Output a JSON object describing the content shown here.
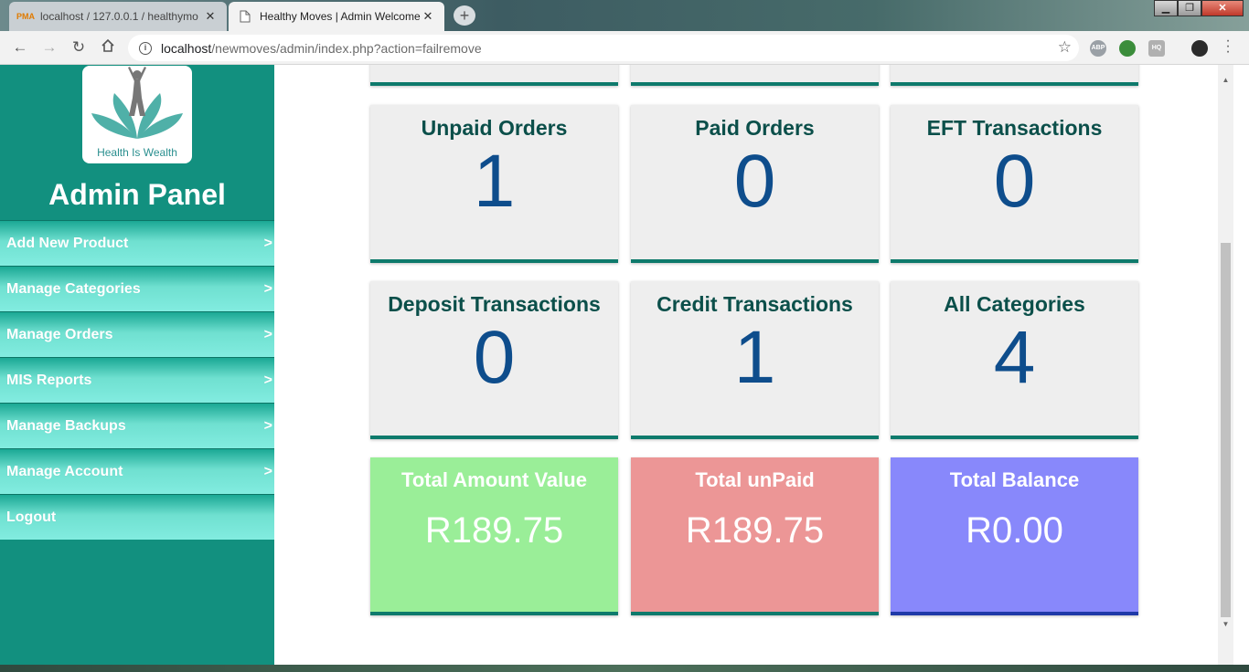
{
  "browser": {
    "tabs": [
      {
        "favicon": "pma-icon",
        "favicon_text": "PMA",
        "title": "localhost / 127.0.0.1 / healthymo"
      },
      {
        "favicon": "page-icon",
        "title": "Healthy Moves | Admin Welcome"
      }
    ],
    "url_host": "localhost",
    "url_path": "/newmoves/admin/index.php?action=failremove",
    "extensions": [
      {
        "name": "abp-icon",
        "text": "ABP",
        "color": "#9aa0a6"
      },
      {
        "name": "globe-icon",
        "text": "",
        "color": "#3b8d3b"
      },
      {
        "name": "cloudhq-icon",
        "text": "HQ",
        "color": "#b0b0b0"
      },
      {
        "name": "profile-icon",
        "text": "",
        "color": "#2b2b2b"
      }
    ]
  },
  "sidebar": {
    "logo_caption": "Health Is Wealth",
    "title": "Admin Panel",
    "items": [
      {
        "label": "Add New Product",
        "arrow": ">"
      },
      {
        "label": "Manage Categories",
        "arrow": ">"
      },
      {
        "label": "Manage Orders",
        "arrow": ">"
      },
      {
        "label": "MIS Reports",
        "arrow": ">"
      },
      {
        "label": "Manage Backups",
        "arrow": ">"
      },
      {
        "label": "Manage Account",
        "arrow": ">"
      },
      {
        "label": "Logout",
        "arrow": ""
      }
    ]
  },
  "stats": [
    {
      "title": "Unpaid Orders",
      "value": "1"
    },
    {
      "title": "Paid Orders",
      "value": "0"
    },
    {
      "title": "EFT Transactions",
      "value": "0"
    },
    {
      "title": "Deposit Transactions",
      "value": "0"
    },
    {
      "title": "Credit Transactions",
      "value": "1"
    },
    {
      "title": "All Categories",
      "value": "4"
    }
  ],
  "totals": [
    {
      "title": "Total Amount Value",
      "value": "R189.75",
      "color": "#9aee98",
      "border": "#0e7a6c"
    },
    {
      "title": "Total unPaid",
      "value": "R189.75",
      "color": "#ec9696",
      "border": "#0e7a6c"
    },
    {
      "title": "Total Balance",
      "value": "R0.00",
      "color": "#8888fb",
      "border": "#1f3aa8"
    }
  ],
  "colors": {
    "sidebar": "#12907f",
    "accent": "#0e7a6c",
    "value_blue": "#0e4d8c"
  }
}
